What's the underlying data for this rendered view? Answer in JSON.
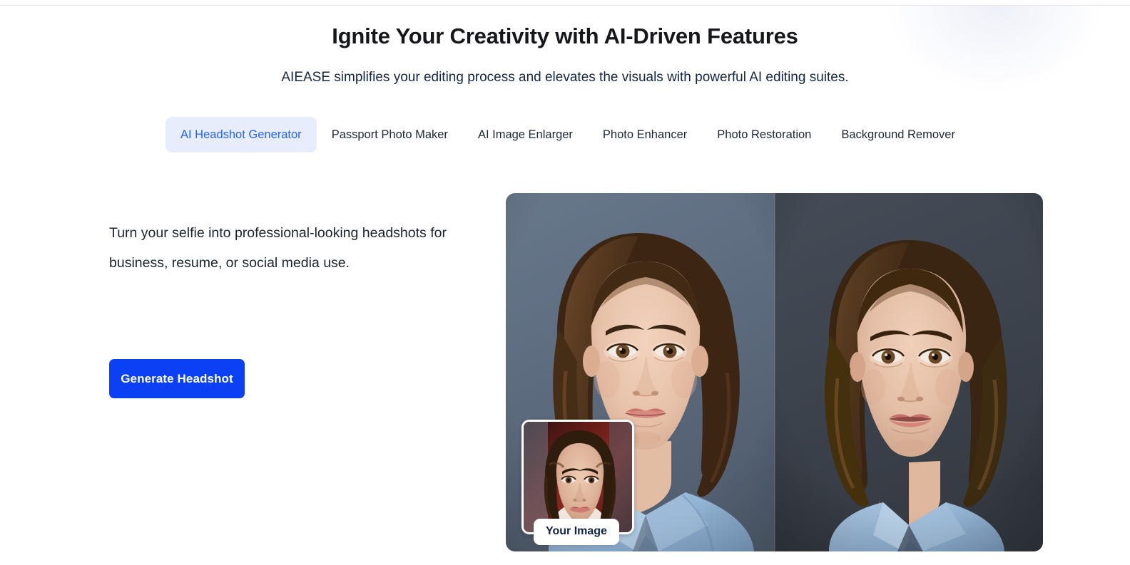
{
  "header": {
    "title": "Ignite Your Creativity with AI-Driven Features",
    "subtitle": "AIEASE simplifies your editing process and elevates the visuals with powerful AI editing suites."
  },
  "tabs": [
    {
      "label": "AI Headshot Generator",
      "active": true
    },
    {
      "label": "Passport Photo Maker",
      "active": false
    },
    {
      "label": "AI Image Enlarger",
      "active": false
    },
    {
      "label": "Photo Enhancer",
      "active": false
    },
    {
      "label": "Photo Restoration",
      "active": false
    },
    {
      "label": "Background Remover",
      "active": false
    }
  ],
  "panel": {
    "description": "Turn your selfie into professional-looking headshots for business, resume, or social media use.",
    "cta_label": "Generate Headshot",
    "thumbnail_label": "Your Image"
  },
  "colors": {
    "accent_blue": "#0b40f5",
    "tab_active_text": "#2563ff",
    "tab_active_bg": "#e7edfd",
    "heading": "#15171a",
    "subheading": "#14263f",
    "body_text": "#1d232c",
    "badge_text": "#0f2344",
    "left_backdrop": "#5d6b7c",
    "right_backdrop": "#3b414b",
    "shirt_blue": "#93b4d4"
  }
}
